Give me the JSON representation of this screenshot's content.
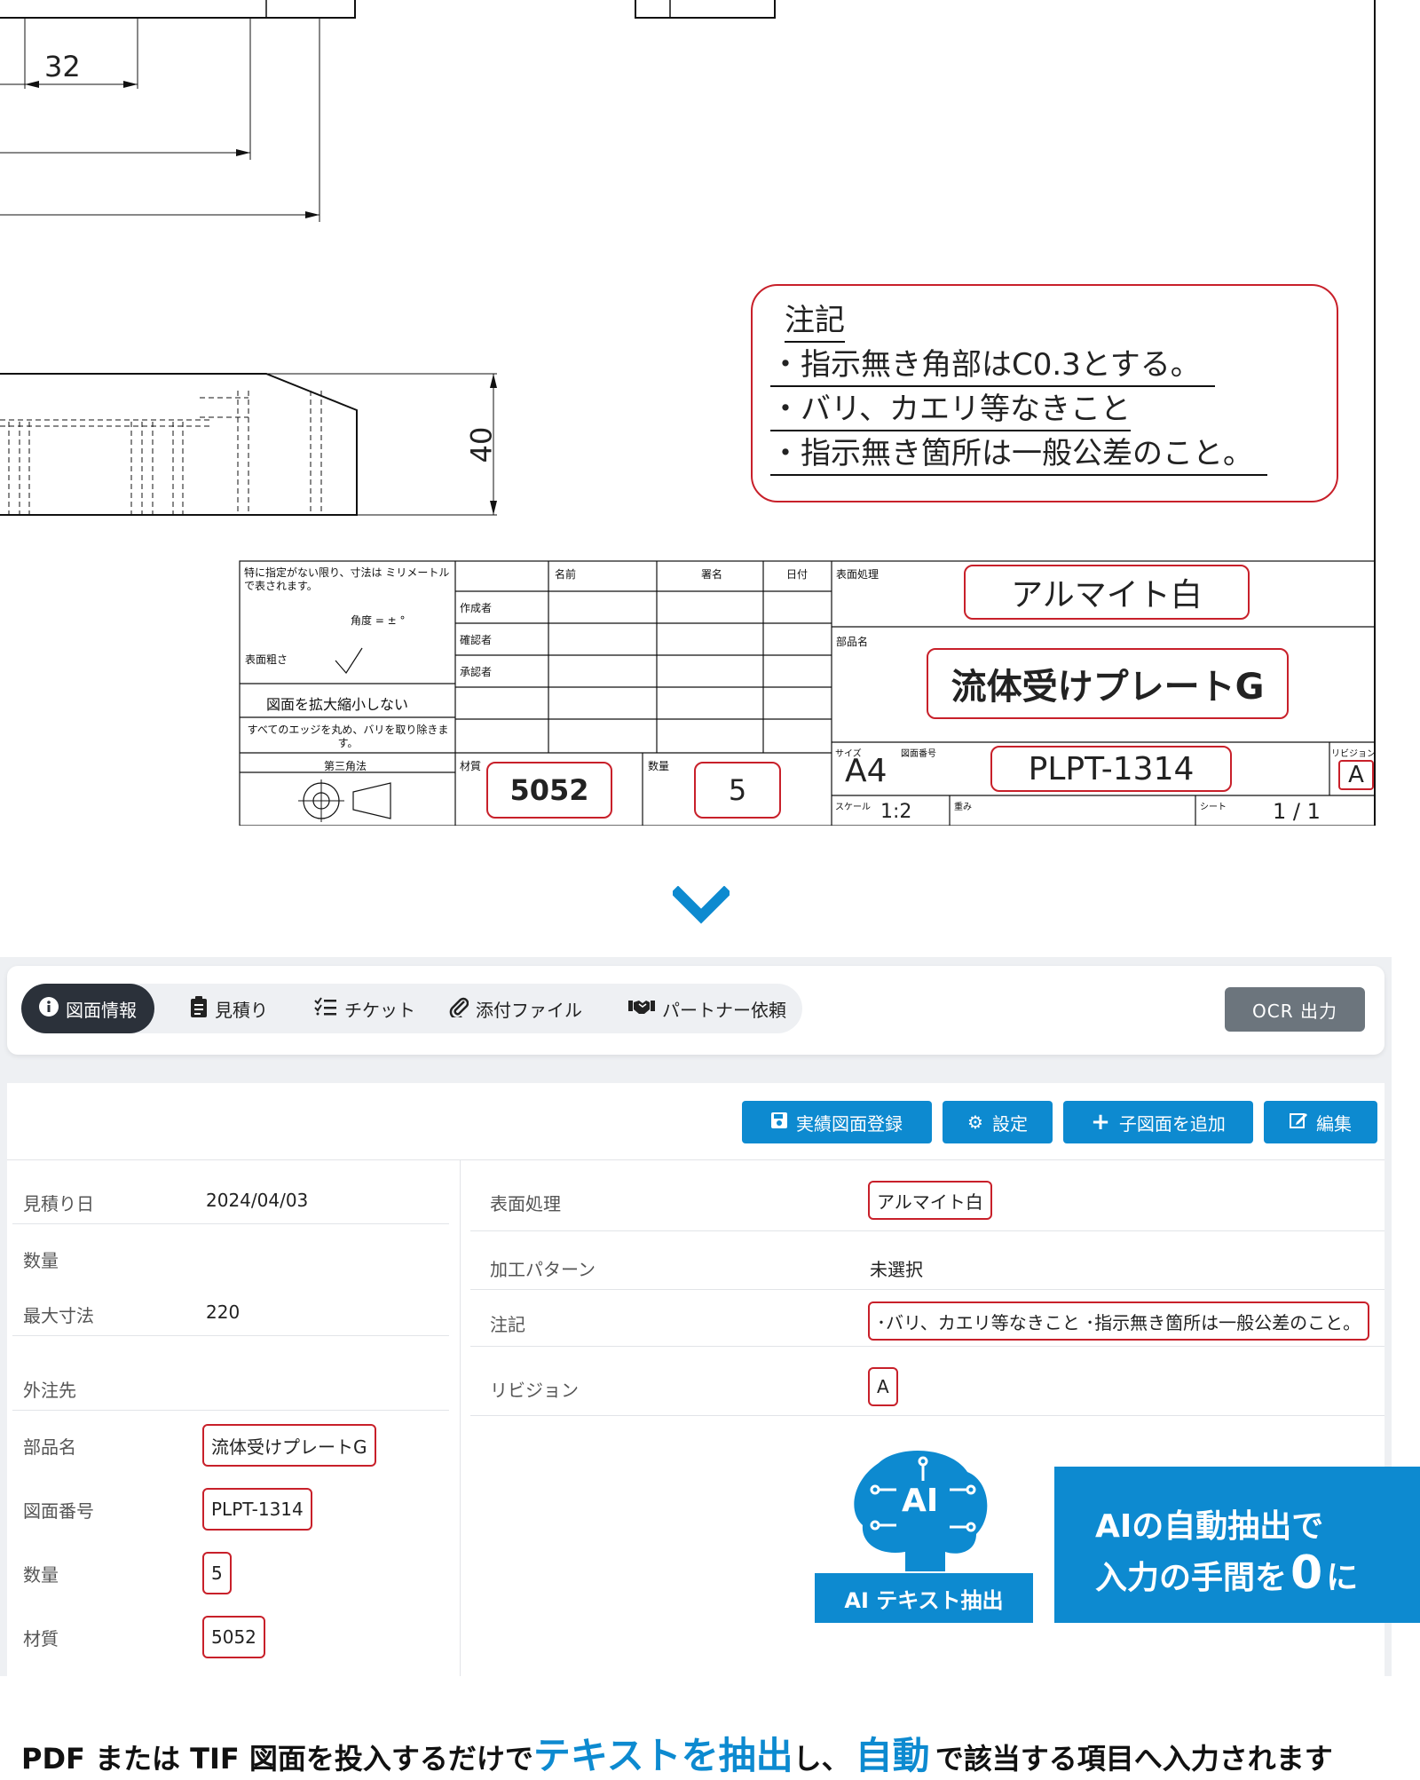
{
  "drawing": {
    "dim_32": "32",
    "dim_40": "40",
    "notes": {
      "title": "注記",
      "lines": [
        "・指示無き角部はC0.3とする。",
        "・バリ、カエリ等なきこと",
        "・指示無き箇所は一般公差のこと。"
      ]
    },
    "title_block": {
      "general_note": "特に指定がない限り、寸法は ミリメートル で表されます。",
      "angle": "角度 = ± °",
      "roughness": "表面粗さ",
      "no_scale": "図面を拡大縮小しない",
      "edges": "すべてのエッジを丸め、バリを取り除きます。",
      "projection": "第三角法",
      "col_name": "名前",
      "col_sign": "署名",
      "col_date": "日付",
      "row_creator": "作成者",
      "row_checker": "確認者",
      "row_approver": "承認者",
      "material_label": "材質",
      "material_value": "5052",
      "qty_label": "数量",
      "qty_value": "5",
      "surface_label": "表面処理",
      "surface_value": "アルマイト白",
      "part_label": "部品名",
      "part_value": "流体受けプレートG",
      "size_label": "サイズ",
      "size_value": "A4",
      "dwg_no_label": "図面番号",
      "dwg_no_value": "PLPT-1314",
      "rev_label": "リビジョン",
      "rev_value": "A",
      "scale_label": "スケール",
      "scale_value": "1:2",
      "weight_label": "重み",
      "sheet_label": "シート",
      "sheet_value": "1 / 1"
    }
  },
  "arrow_icon": "chevron-down-icon",
  "app": {
    "tabs": [
      {
        "label": "図面情報",
        "icon": "info-icon"
      },
      {
        "label": "見積り",
        "icon": "clipboard-icon"
      },
      {
        "label": "チケット",
        "icon": "checklist-icon"
      },
      {
        "label": "添付ファイル",
        "icon": "paperclip-icon"
      },
      {
        "label": "パートナー依頼",
        "icon": "handshake-icon"
      }
    ],
    "ocr_button": "OCR 出力",
    "actions": [
      {
        "label": "実績図面登録",
        "icon": "save-icon"
      },
      {
        "label": "設定",
        "icon": "gear-icon"
      },
      {
        "label": "子図面を追加",
        "icon": "plus-icon"
      },
      {
        "label": "編集",
        "icon": "edit-icon"
      }
    ],
    "left_fields": [
      {
        "label": "見積り日",
        "value": "2024/04/03"
      },
      {
        "label": "数量",
        "value": ""
      },
      {
        "label": "最大寸法",
        "value": "220"
      },
      {
        "label": "外注先",
        "value": ""
      },
      {
        "label": "部品名",
        "value": "流体受けプレートG"
      },
      {
        "label": "図面番号",
        "value": "PLPT-1314"
      },
      {
        "label": "数量",
        "value": "5"
      },
      {
        "label": "材質",
        "value": "5052"
      }
    ],
    "right_fields": [
      {
        "label": "表面処理",
        "value": "アルマイト白"
      },
      {
        "label": "加工パターン",
        "value": "未選択"
      },
      {
        "label": "注記",
        "value": "･バリ、カエリ等なきこと ･指示無き箇所は一般公差のこと。"
      },
      {
        "label": "リビジョン",
        "value": "A"
      }
    ],
    "ai_badge": "AI",
    "ai_label": "AI テキスト抽出",
    "promo_line1": "AIの自動抽出で",
    "promo_line2a": "入力の手間を",
    "promo_zero": "0",
    "promo_line2b": "に"
  },
  "caption": {
    "part1": "PDF または TIF 図面を投入するだけで",
    "hl1": "テキストを抽出",
    "part2": "し、",
    "hl2": "自動",
    "part3": "で該当する項目へ入力されます"
  },
  "colors": {
    "accent": "#0d8ad0",
    "highlight": "#c8202a",
    "dark_tab": "#2b313a",
    "ocr_button": "#6c757d"
  }
}
